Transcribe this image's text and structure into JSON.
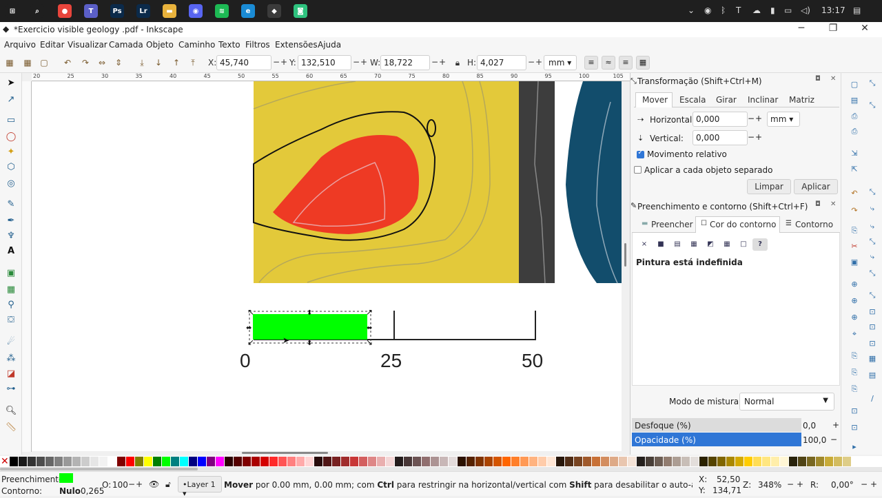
{
  "taskbar": {
    "apps": [
      {
        "name": "start-icon",
        "label": "⊞",
        "color": "#1f1f1f"
      },
      {
        "name": "search-icon",
        "label": "⌕",
        "color": "#1f1f1f"
      },
      {
        "name": "chrome-icon",
        "label": "●",
        "color": "#e8453c"
      },
      {
        "name": "teams-icon",
        "label": "T",
        "color": "#5b5fc7"
      },
      {
        "name": "photoshop-icon",
        "label": "Ps",
        "color": "#0b2a4a"
      },
      {
        "name": "lightroom-icon",
        "label": "Lr",
        "color": "#0b2a4a"
      },
      {
        "name": "file-explorer-icon",
        "label": "▬",
        "color": "#e8b23c"
      },
      {
        "name": "discord-icon",
        "label": "◉",
        "color": "#5865f2"
      },
      {
        "name": "spotify-icon",
        "label": "≋",
        "color": "#1db954"
      },
      {
        "name": "edge-icon",
        "label": "e",
        "color": "#1a8bd4"
      },
      {
        "name": "inkscape-icon",
        "label": "◆",
        "color": "#3b3b3b"
      },
      {
        "name": "app-green-icon",
        "label": "◙",
        "color": "#2ec27e"
      }
    ],
    "clock": "13:17"
  },
  "window": {
    "title": "*Exercicio visible geology .pdf - Inkscape"
  },
  "menu": [
    "Arquivo",
    "Editar",
    "Visualizar",
    "Camada",
    "Objeto",
    "Caminho",
    "Texto",
    "Filtros",
    "Extensões",
    "Ajuda"
  ],
  "toolbar": {
    "x_label": "X:",
    "x_value": "45,740",
    "y_label": "Y:",
    "y_value": "132,510",
    "w_label": "W:",
    "w_value": "18,722",
    "h_label": "H:",
    "h_value": "4,027",
    "unit": "mm",
    "minus": "−",
    "plus": "+"
  },
  "ruler_top": [
    "20",
    "25",
    "30",
    "35",
    "40",
    "45",
    "50",
    "55",
    "60",
    "65",
    "70",
    "75",
    "80",
    "85",
    "90",
    "95",
    "100",
    "105"
  ],
  "canvas": {
    "scale_labels": [
      "0",
      "25",
      "50"
    ],
    "contour_label": "0"
  },
  "panel": {
    "transform": {
      "title": "Transformação (Shift+Ctrl+M)",
      "tabs": [
        "Mover",
        "Escala",
        "Girar",
        "Inclinar",
        "Matriz"
      ],
      "horizontal_label": "Horizontal:",
      "horizontal_value": "0,000",
      "vertical_label": "Vertical:",
      "vertical_value": "0,000",
      "unit": "mm",
      "relative_label": "Movimento relativo",
      "relative_checked": true,
      "each_label": "Aplicar a cada objeto separado",
      "each_checked": false,
      "clear_label": "Limpar",
      "apply_label": "Aplicar"
    },
    "fillstroke": {
      "title": "Preenchimento e contorno (Shift+Ctrl+F)",
      "tabs": [
        "Preencher",
        "Cor do contorno",
        "Contorno"
      ],
      "paint_status": "Pintura está indefinida",
      "paint_buttons": [
        "×",
        "■",
        "▤",
        "▦",
        "◩",
        "▦",
        "□",
        "?"
      ],
      "blend_label": "Modo de mistura:",
      "blend_value": "Normal",
      "blur_label": "Desfoque (%)",
      "blur_value": "0,0",
      "opacity_label": "Opacidade (%)",
      "opacity_value": "100,0"
    }
  },
  "status": {
    "fill_label": "Preenchimento:",
    "fill_color": "#00ff00",
    "stroke_label": "Contorno:",
    "stroke_value": "Nulo",
    "stroke_width": "0,265",
    "opacity_label": "O:",
    "opacity_value": "100",
    "layer": "•Layer 1",
    "message_bold1": "Mover",
    "message_1": " por 0.00 mm, 0.00 mm; com ",
    "message_bold2": "Ctrl",
    "message_2": " para restringir na horizontal/vertical com ",
    "message_bold3": "Shift",
    "message_3": " para desabilitar o auto-alinhamento",
    "cursor_x_label": "X:",
    "cursor_x": "52,50",
    "cursor_y_label": "Y:",
    "cursor_y": "134,71",
    "zoom_label": "Z:",
    "zoom": "348%",
    "rotate_label": "R:",
    "rotate": "0,00°"
  },
  "palette": [
    "#000000",
    "#1a1a1a",
    "#333333",
    "#4d4d4d",
    "#666666",
    "#808080",
    "#999999",
    "#b3b3b3",
    "#cccccc",
    "#e6e6e6",
    "#f2f2f2",
    "#ffffff",
    "#800000",
    "#ff0000",
    "#808000",
    "#ffff00",
    "#008000",
    "#00ff00",
    "#008080",
    "#00ffff",
    "#000080",
    "#0000ff",
    "#800080",
    "#ff00ff",
    "#2b0000",
    "#550000",
    "#800000",
    "#aa0000",
    "#d40000",
    "#ff2a2a",
    "#ff5555",
    "#ff8080",
    "#ffaaaa",
    "#ffd5d5",
    "#280b0b",
    "#501616",
    "#782121",
    "#a02c2c",
    "#c83737",
    "#d35f5f",
    "#de8787",
    "#e9afaf",
    "#f4d7d7",
    "#241c1c",
    "#483737",
    "#6c5353",
    "#916f6f",
    "#ac9393",
    "#c8b7b7",
    "#e3dbdb",
    "#2b1100",
    "#552200",
    "#803300",
    "#aa4400",
    "#d45500",
    "#ff6600",
    "#ff7f2a",
    "#ff9955",
    "#ffb380",
    "#ffccaa",
    "#ffe6d5",
    "#28170b",
    "#502d16",
    "#784421",
    "#a05a2c",
    "#c87137",
    "#d38d5f",
    "#deaa87",
    "#e9c6af",
    "#f4e3d7",
    "#241f1c",
    "#483e37",
    "#6c5d53",
    "#917c6f",
    "#ac9d93",
    "#c8beb7",
    "#e3dedb",
    "#2b2200",
    "#554400",
    "#806600",
    "#aa8800",
    "#d4aa00",
    "#ffcc00",
    "#ffdd55",
    "#ffe680",
    "#ffeeaa",
    "#fff6d5",
    "#28220b",
    "#504416",
    "#786721",
    "#a0892c",
    "#c8ab37",
    "#d3bc5f",
    "#decd87"
  ]
}
